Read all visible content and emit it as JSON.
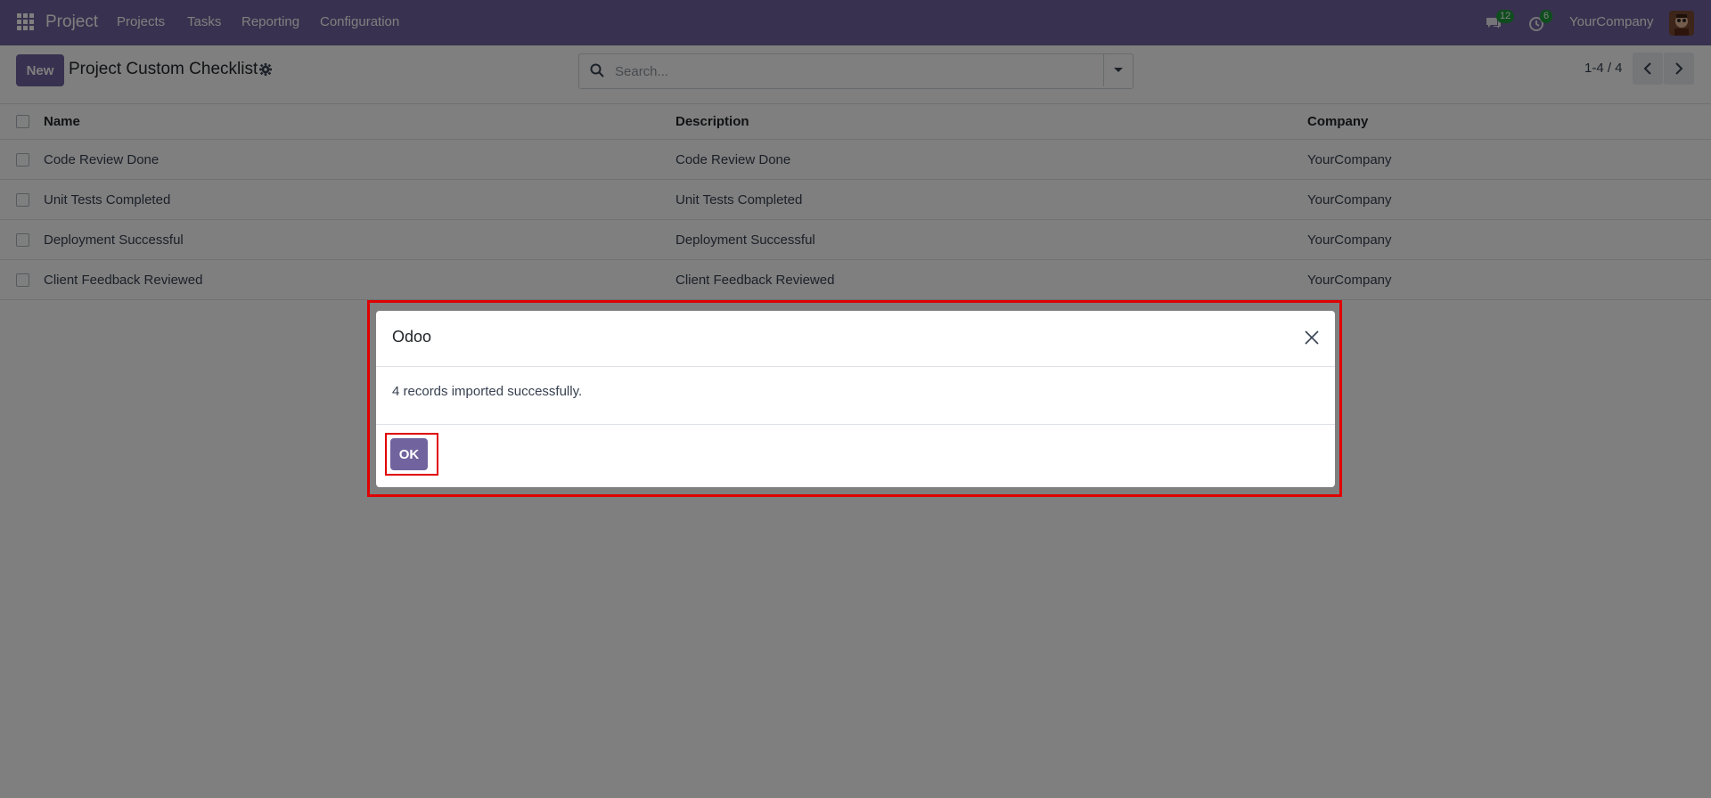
{
  "navbar": {
    "app_name": "Project",
    "menus": [
      "Projects",
      "Tasks",
      "Reporting",
      "Configuration"
    ],
    "messages_badge": "12",
    "activities_badge": "6",
    "company": "YourCompany",
    "bg_color": "#71639e"
  },
  "control_panel": {
    "new_label": "New",
    "title": "Project Custom Checklist",
    "search_placeholder": "Search...",
    "pager": "1-4 / 4"
  },
  "list": {
    "columns": [
      "Name",
      "Description",
      "Company"
    ],
    "rows": [
      {
        "name": "Code Review Done",
        "description": "Code Review Done",
        "company": "YourCompany"
      },
      {
        "name": "Unit Tests Completed",
        "description": "Unit Tests Completed",
        "company": "YourCompany"
      },
      {
        "name": "Deployment Successful",
        "description": "Deployment Successful",
        "company": "YourCompany"
      },
      {
        "name": "Client Feedback Reviewed",
        "description": "Client Feedback Reviewed",
        "company": "YourCompany"
      }
    ]
  },
  "dialog": {
    "title": "Odoo",
    "message": "4 records imported successfully.",
    "ok_label": "OK",
    "highlight_color": "#e00000"
  }
}
